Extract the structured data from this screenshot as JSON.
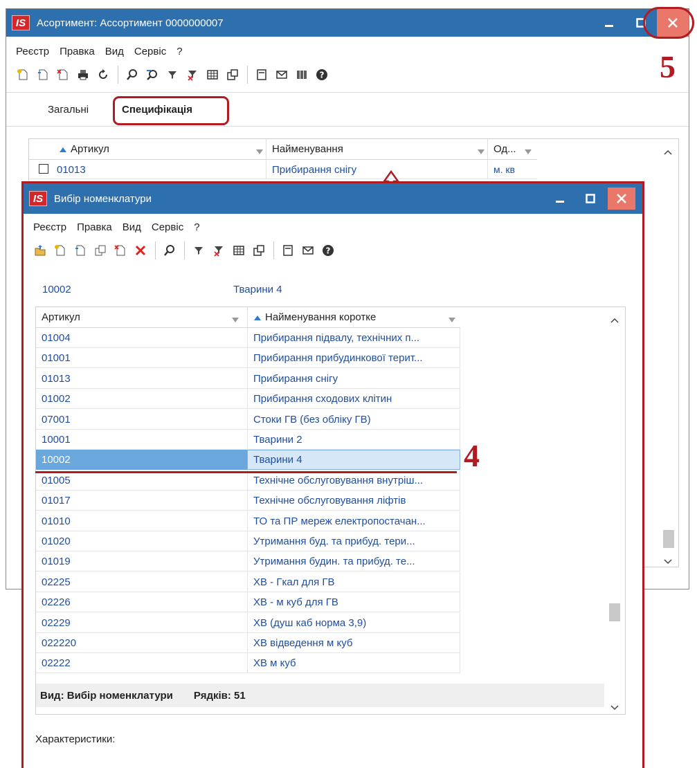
{
  "main_window": {
    "title": "Асортимент: Ассортимент 0000000007",
    "logo": "IS",
    "menu": [
      "Реєстр",
      "Правка",
      "Вид",
      "Сервіс",
      "?"
    ],
    "toolbar_icons": [
      "new-doc-icon",
      "copy-doc-icon",
      "delete-doc-icon",
      "print-icon",
      "refresh-icon",
      "find-icon",
      "find-next-icon",
      "filter-icon",
      "clear-filter-icon",
      "grid-icon",
      "export-icon",
      "form-icon",
      "mail-icon",
      "barcode-icon",
      "help-icon"
    ],
    "tabs": [
      "Загальні",
      "Специфікація"
    ],
    "grid": {
      "headers": [
        "Артикул",
        "Найменування",
        "Од..."
      ],
      "rows": [
        {
          "article": "01013",
          "name": "Прибирання снігу",
          "unit": "м. кв"
        }
      ]
    }
  },
  "dialog": {
    "title": "Вибір номенклатури",
    "logo": "IS",
    "menu": [
      "Реєстр",
      "Правка",
      "Вид",
      "Сервіс",
      "?"
    ],
    "toolbar_icons": [
      "folder-up-icon",
      "new-doc-icon",
      "copy-doc-icon",
      "duplicate-icon",
      "delete-doc-icon",
      "delete-icon",
      "find-icon",
      "filter-icon",
      "clear-filter-icon",
      "grid-icon",
      "export-icon",
      "form-icon",
      "mail-icon",
      "help-icon"
    ],
    "selected_code": "10002",
    "selected_name": "Тварини 4",
    "grid": {
      "headers": [
        "Артикул",
        "Найменування коротке"
      ],
      "selected_index": 6,
      "rows": [
        {
          "article": "01004",
          "name": "Прибирання підвалу, технічних п..."
        },
        {
          "article": "01001",
          "name": "Прибирання прибудинкової терит..."
        },
        {
          "article": "01013",
          "name": "Прибирання снігу"
        },
        {
          "article": "01002",
          "name": "Прибирання сходових клітин"
        },
        {
          "article": "07001",
          "name": "Стоки ГВ (без обліку ГВ)"
        },
        {
          "article": "10001",
          "name": "Тварини 2"
        },
        {
          "article": "10002",
          "name": "Тварини 4"
        },
        {
          "article": "01005",
          "name": "Технічне обслуговування внутріш..."
        },
        {
          "article": "01017",
          "name": "Технічне обслуговування ліфтів"
        },
        {
          "article": "01010",
          "name": "ТО та ПР мереж електропостачан..."
        },
        {
          "article": "01020",
          "name": "Утримання буд. та прибуд. тери..."
        },
        {
          "article": "01019",
          "name": "Утримання будин. та прибуд. те..."
        },
        {
          "article": "02225",
          "name": "ХВ - Гкал для ГВ"
        },
        {
          "article": "02226",
          "name": "ХВ - м куб для ГВ"
        },
        {
          "article": "02229",
          "name": "ХВ (душ каб норма 3,9)"
        },
        {
          "article": "022220",
          "name": "ХВ відведення м куб"
        },
        {
          "article": "02222",
          "name": "ХВ м куб"
        }
      ]
    },
    "status_view": "Вид: Вибір номенклатури",
    "status_rows": "Рядків: 51",
    "characteristics_label": "Характеристики:"
  },
  "annotations": {
    "step4": "4",
    "step5": "5"
  },
  "colors": {
    "titlebar": "#2e6fae",
    "accent_red": "#b01c22",
    "selection": "#6aa7dd"
  }
}
